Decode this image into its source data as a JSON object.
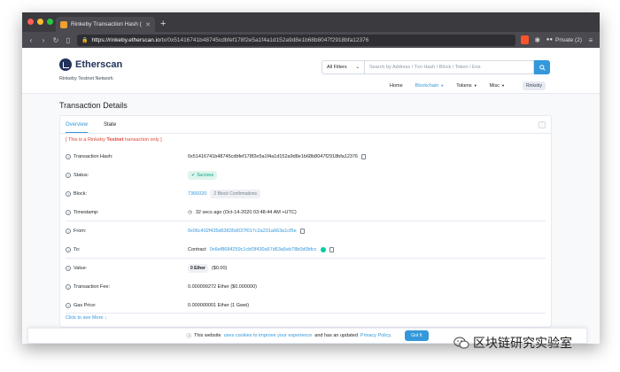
{
  "browser": {
    "tab_title": "Rinkeby Transaction Hash (Txh...",
    "new_tab": "+",
    "url_host": "https://rinkeby.etherscan.io",
    "url_path": "/tx/0x51416741b48745cdbfef178f2e5a1f4a1d152a9d8e1b68b8047f2918bfa12376",
    "private_label": "Private (2)",
    "menu_glyph": "≡"
  },
  "header": {
    "logo_text": "Etherscan",
    "network": "Rinkeby Testnet Network",
    "filter_label": "All Filters",
    "search_placeholder": "Search by Address / Txn Hash / Block / Token / Ens",
    "menu": [
      {
        "label": "Home"
      },
      {
        "label": "Blockchain"
      },
      {
        "label": "Tokens"
      },
      {
        "label": "Misc"
      }
    ],
    "network_chip": "Rinkeby"
  },
  "page": {
    "title": "Transaction Details",
    "tabs": [
      {
        "label": "Overview"
      },
      {
        "label": "State"
      }
    ],
    "notice_pre": "[ This is a Rinkeby ",
    "notice_bold": "Testnet",
    "notice_post": " transaction only ]",
    "rows": {
      "hash": {
        "label": "Transaction Hash:",
        "value": "0x51416741b48745cdbfef178f2e5a1f4a1d152a9d8e1b68b8047f2918bfa12376"
      },
      "status": {
        "label": "Status:",
        "value": "Success"
      },
      "block": {
        "label": "Block:",
        "value": "7366020",
        "confirmations": "2 Block Confirmations"
      },
      "timestamp": {
        "label": "Timestamp:",
        "value": "32 secs ago (Oct-14-2020 03:48:44 AM +UTC)"
      },
      "from": {
        "label": "From:",
        "value": "0x06c402f435d63835d037f017c2a231a663a1cf5e"
      },
      "to": {
        "label": "To:",
        "prefix": "Contract",
        "value": "0x6ef8684259c1cbf3f430a57d63a5eb78b0d0bfcc"
      },
      "value": {
        "label": "Value:",
        "amount": "0 Ether",
        "usd": "($0.00)"
      },
      "fee": {
        "label": "Transaction Fee:",
        "value": "0.000099272 Ether ($0.000000)"
      },
      "gas": {
        "label": "Gas Price:",
        "value": "0.000000001 Ether (1 Gwei)"
      }
    },
    "more_link": "Click to see More"
  },
  "cookie": {
    "pre": "This website",
    "link1": "uses cookies to improve your experience",
    "mid": "and has an updated",
    "link2": "Privacy Policy.",
    "button": "Got It"
  },
  "watermark": {
    "text": "区块链研究实验室"
  },
  "colors": {
    "accent": "#3498db",
    "success": "#00a186",
    "danger": "#de4437",
    "brand": "#21325b"
  }
}
